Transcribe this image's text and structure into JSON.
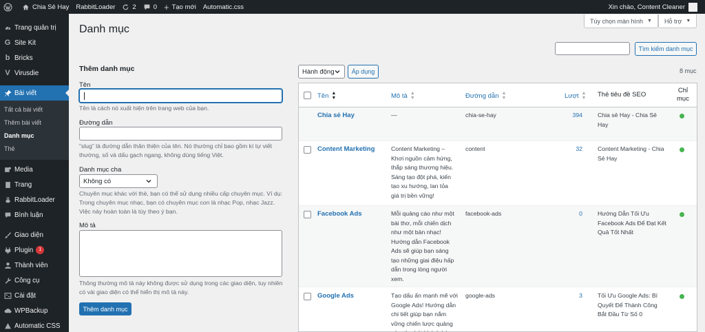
{
  "admin_bar": {
    "site_name": "Chia Sẻ Hay",
    "plugin": "RabbitLoader",
    "updates_count": "2",
    "comments_count": "0",
    "new_label": "Tạo mới",
    "automatic_css": "Automatic.css",
    "greeting": "Xin chào, Content Cleaner"
  },
  "sidebar": {
    "items_top": [
      {
        "label": "Trang quản trị",
        "icon": "dashboard-icon"
      },
      {
        "label": "Site Kit",
        "icon": "google-g-icon"
      },
      {
        "label": "Bricks",
        "icon": "bricks-b-icon"
      },
      {
        "label": "Virusdie",
        "icon": "virusdie-v-icon"
      }
    ],
    "current": {
      "label": "Bài viết",
      "icon": "pin-icon"
    },
    "submenu": [
      "Tất cả bài viết",
      "Thêm bài viết",
      "Danh mục",
      "Thẻ"
    ],
    "items_bottom": [
      {
        "label": "Media",
        "icon": "media-icon"
      },
      {
        "label": "Trang",
        "icon": "page-icon"
      },
      {
        "label": "RabbitLoader",
        "icon": "rabbit-icon"
      },
      {
        "label": "Bình luận",
        "icon": "comment-icon"
      },
      {
        "label": "Giao diện",
        "icon": "brush-icon"
      },
      {
        "label": "Plugin",
        "icon": "plugin-icon",
        "badge": "1"
      },
      {
        "label": "Thành viên",
        "icon": "users-icon"
      },
      {
        "label": "Công cụ",
        "icon": "tools-icon"
      },
      {
        "label": "Cài đặt",
        "icon": "settings-icon"
      },
      {
        "label": "WPBackup",
        "icon": "backup-icon"
      },
      {
        "label": "Automatic CSS",
        "icon": "acss-icon"
      }
    ]
  },
  "header": {
    "page_title": "Danh mục",
    "screen_options": "Tùy chọn màn hình",
    "help": "Hỗ trợ",
    "search_button": "Tìm kiếm danh mục",
    "search_value": ""
  },
  "form": {
    "title": "Thêm danh mục",
    "name_label": "Tên",
    "name_desc": "Tên là cách nó xuất hiện trên trang web của bạn.",
    "slug_label": "Đường dẫn",
    "slug_desc": "“slug” là đường dẫn thân thiện của tên. Nó thường chỉ bao gồm kí tự viết thường, số và dấu gạch ngang, không dùng tiếng Việt.",
    "parent_label": "Danh mục cha",
    "parent_selected": "Không có",
    "parent_desc": "Chuyên mục khác với thẻ, bạn có thể sử dụng nhiều cấp chuyên mục. Ví dụ: Trong chuyên mục nhạc, bạn có chuyên mục con là nhạc Pop, nhạc Jazz. Việc này hoàn toàn là tùy theo ý bạn.",
    "desc_label": "Mô tả",
    "desc_desc": "Thông thường mô tả này không được sử dụng trong các giao diện, tuy nhiên có vài giao diện có thể hiển thị mô tả này.",
    "submit": "Thêm danh mục"
  },
  "table": {
    "bulk_action": "Hành động",
    "apply": "Áp dụng",
    "count": "8 mục",
    "headers": {
      "name": "Tên",
      "description": "Mô tả",
      "slug": "Đường dẫn",
      "count": "Lượt",
      "seo_title": "Thẻ tiêu đề SEO",
      "index_line1": "Chỉ",
      "index_line2": "mục"
    },
    "rows": [
      {
        "name": "Chia sẻ Hay",
        "description": "—",
        "slug": "chia-se-hay",
        "count": "394",
        "seo_title": "Chia sẻ Hay - Chia Sẻ Hay",
        "indexed": true
      },
      {
        "name": "Content Marketing",
        "description": "Content Marketing – Khơi nguồn cảm hứng, thắp sáng thương hiệu. Sáng tạo đột phá, kiến tạo xu hướng, lan tỏa giá trị bền vững!",
        "slug": "content",
        "count": "32",
        "seo_title": "Content Marketing - Chia Sẻ Hay",
        "indexed": true
      },
      {
        "name": "Facebook Ads",
        "description": "Mỗi quảng cáo như một bài thơ, mỗi chiến dịch như một bản nhạc! Hướng dẫn Facebook Ads sẽ giúp bạn sáng tạo những giai điệu hấp dẫn trong lòng người xem.",
        "slug": "facebook-ads",
        "count": "0",
        "seo_title": "Hướng Dẫn Tối Ưu Facebook Ads Để Đạt Kết Quả Tốt Nhất",
        "indexed": true
      },
      {
        "name": "Google Ads",
        "description": "Tạo dấu ấn mạnh mẽ với Google Ads! Hướng dẫn chi tiết giúp bạn nắm vững chiến lược quảng cáo, thu hút khách hàng",
        "slug": "google-ads",
        "count": "3",
        "seo_title": "Tối Ưu Google Ads: Bí Quyết Để Thành Công Bắt Đầu Từ Số 0",
        "indexed": true
      }
    ]
  },
  "colors": {
    "admin_dark": "#1d2327",
    "accent": "#2271b1",
    "success": "#46b450",
    "bg": "#f0f0f1"
  }
}
